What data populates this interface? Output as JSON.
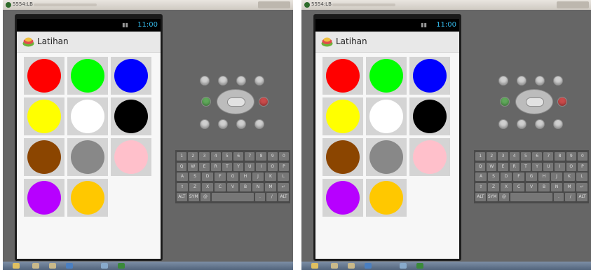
{
  "window": {
    "title": "5554:LB"
  },
  "phone": {
    "status_time": "11:00",
    "app_title": "Latihan",
    "time_color": "#33b5e5"
  },
  "swatches": [
    {
      "name": "red",
      "color": "#ff0000"
    },
    {
      "name": "green",
      "color": "#00ff00"
    },
    {
      "name": "blue",
      "color": "#0000ff"
    },
    {
      "name": "yellow",
      "color": "#ffff00"
    },
    {
      "name": "white",
      "color": "#ffffff"
    },
    {
      "name": "black",
      "color": "#000000"
    },
    {
      "name": "brown",
      "color": "#8b4500"
    },
    {
      "name": "gray",
      "color": "#888888"
    },
    {
      "name": "pink",
      "color": "#ffc0cb"
    },
    {
      "name": "purple",
      "color": "#b700ff"
    },
    {
      "name": "gold",
      "color": "#ffc800"
    }
  ],
  "keyboard_rows": [
    [
      "1",
      "2",
      "3",
      "4",
      "5",
      "6",
      "7",
      "8",
      "9",
      "0"
    ],
    [
      "Q",
      "W",
      "E",
      "R",
      "T",
      "Y",
      "U",
      "I",
      "O",
      "P"
    ],
    [
      "A",
      "S",
      "D",
      "F",
      "G",
      "H",
      "J",
      "K",
      "L"
    ],
    [
      "⇧",
      "Z",
      "X",
      "C",
      "V",
      "B",
      "N",
      "M",
      "↵"
    ],
    [
      "ALT",
      "SYM",
      "@",
      "",
      ".",
      "/",
      "ALT"
    ]
  ],
  "hardware_buttons": [
    "camera-icon",
    "volume-down-icon",
    "volume-up-icon",
    "power-icon",
    "call-icon",
    "end-call-icon",
    "home-icon",
    "menu-icon",
    "back-icon",
    "search-icon"
  ]
}
